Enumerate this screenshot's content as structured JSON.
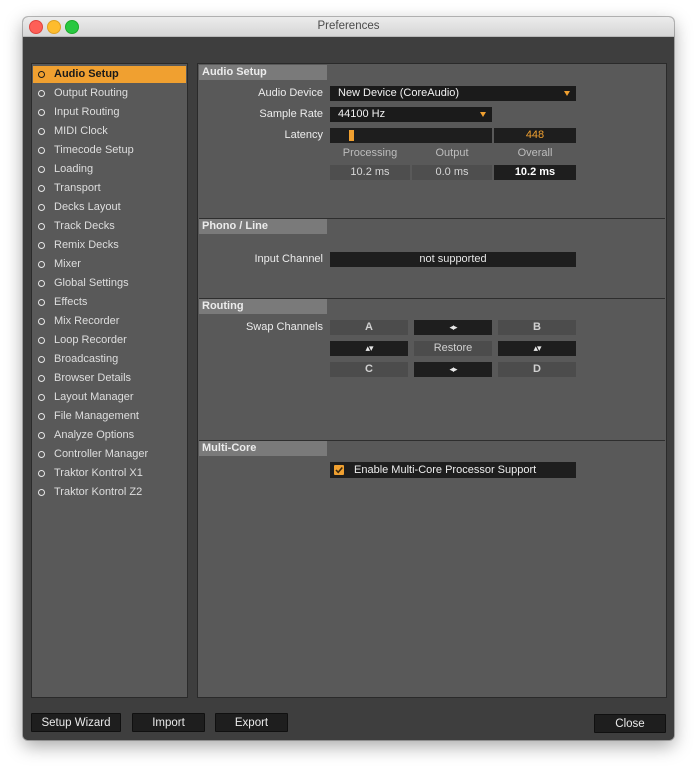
{
  "window": {
    "title": "Preferences"
  },
  "sidebar": {
    "items": [
      {
        "label": "Audio Setup",
        "active": true
      },
      {
        "label": "Output Routing"
      },
      {
        "label": "Input Routing"
      },
      {
        "label": "MIDI Clock"
      },
      {
        "label": "Timecode Setup"
      },
      {
        "label": "Loading"
      },
      {
        "label": "Transport"
      },
      {
        "label": "Decks Layout"
      },
      {
        "label": "Track Decks"
      },
      {
        "label": "Remix Decks"
      },
      {
        "label": "Mixer"
      },
      {
        "label": "Global Settings"
      },
      {
        "label": "Effects"
      },
      {
        "label": "Mix Recorder"
      },
      {
        "label": "Loop Recorder"
      },
      {
        "label": "Broadcasting"
      },
      {
        "label": "Browser Details"
      },
      {
        "label": "Layout Manager"
      },
      {
        "label": "File Management"
      },
      {
        "label": "Analyze Options"
      },
      {
        "label": "Controller Manager"
      },
      {
        "label": "Traktor Kontrol X1"
      },
      {
        "label": "Traktor Kontrol Z2"
      }
    ]
  },
  "audio_setup": {
    "header": "Audio Setup",
    "audio_device_label": "Audio Device",
    "audio_device_value": "New Device (CoreAudio)",
    "sample_rate_label": "Sample Rate",
    "sample_rate_value": "44100 Hz",
    "latency_label": "Latency",
    "latency_value": "448",
    "latency_fraction": 0.05,
    "processing_label": "Processing",
    "output_label": "Output",
    "overall_label": "Overall",
    "processing_value": "10.2 ms",
    "output_value": "0.0 ms",
    "overall_value": "10.2 ms"
  },
  "phono_line": {
    "header": "Phono / Line",
    "input_channel_label": "Input Channel",
    "input_channel_value": "not supported"
  },
  "routing": {
    "header": "Routing",
    "swap_channels_label": "Swap Channels",
    "a": "A",
    "b": "B",
    "c": "C",
    "d": "D",
    "restore": "Restore",
    "arrow_lr": "◂▸",
    "arrow_ud": "▴▾"
  },
  "multi_core": {
    "header": "Multi-Core",
    "enable_label": "Enable Multi-Core Processor Support",
    "enabled": true
  },
  "footer": {
    "setup_wizard": "Setup Wizard",
    "import": "Import",
    "export": "Export",
    "close": "Close"
  },
  "colors": {
    "accent": "#f0a030",
    "panel": "#595959",
    "field": "#1e1e1e"
  }
}
